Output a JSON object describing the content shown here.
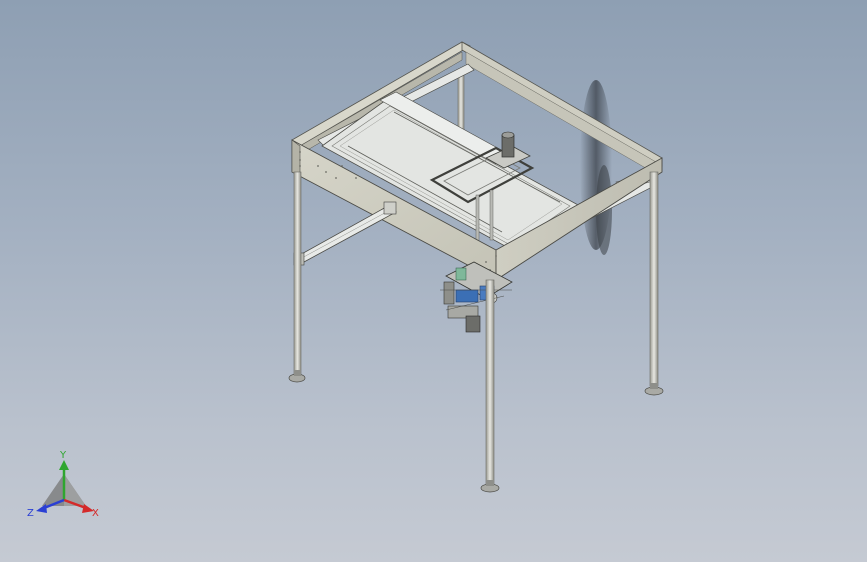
{
  "viewport": {
    "background_top": "#8e9fb3",
    "background_bottom": "#c5cad3"
  },
  "model": {
    "frame_color": "#d3d2c6",
    "rail_color": "#e4e6e4",
    "accent_color": "#3b6fb5",
    "shadow_color": "#2a2f36"
  },
  "triad": {
    "y_label": "Y",
    "x_label": "X",
    "z_label": "Z",
    "x_color": "#d42a2a",
    "y_color": "#2fa62f",
    "z_color": "#2a3fd4"
  }
}
